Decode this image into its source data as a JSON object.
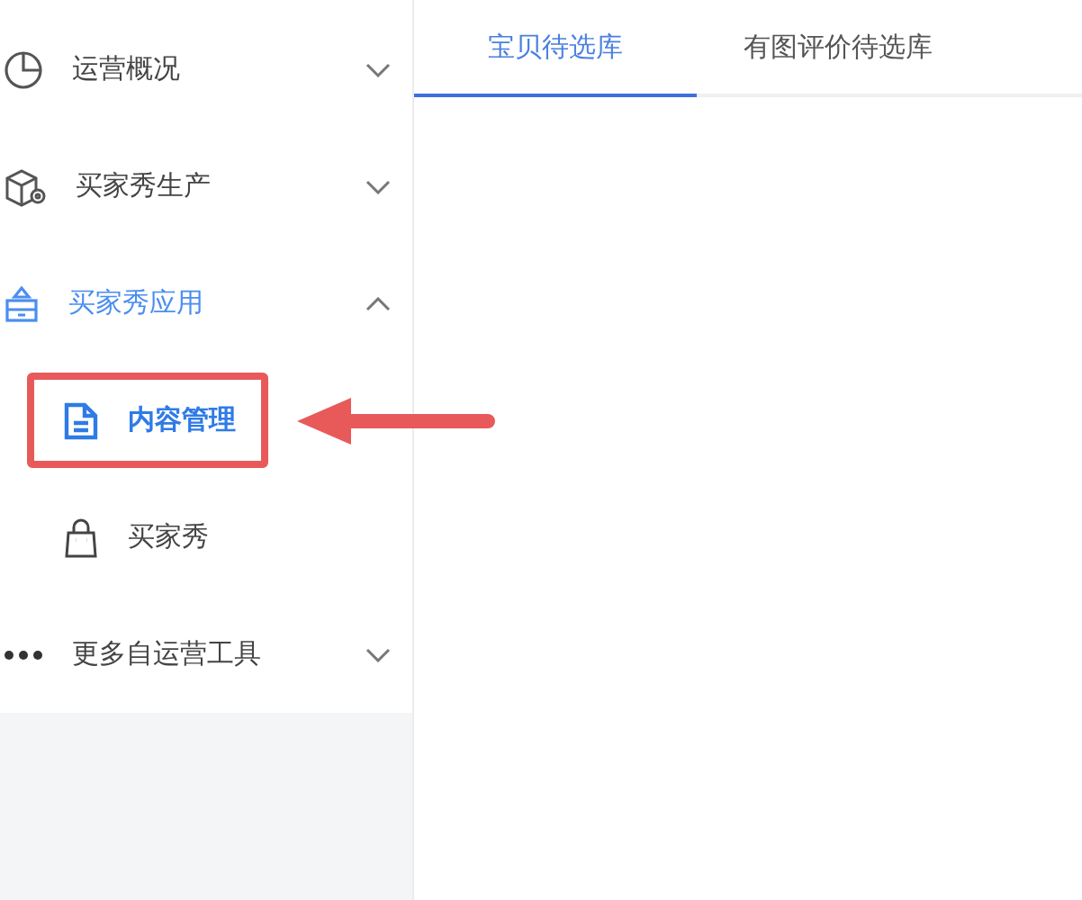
{
  "sidebar": {
    "items": [
      {
        "label": "运营概况",
        "expanded": false,
        "active": false
      },
      {
        "label": "买家秀生产",
        "expanded": false,
        "active": false
      },
      {
        "label": "买家秀应用",
        "expanded": true,
        "active": true,
        "children": [
          {
            "label": "内容管理",
            "selected": true,
            "highlighted": true
          },
          {
            "label": "买家秀",
            "selected": false,
            "highlighted": false
          }
        ]
      },
      {
        "label": "更多自运营工具",
        "expanded": false,
        "active": false
      }
    ]
  },
  "tabs": [
    {
      "label": "宝贝待选库",
      "selected": true
    },
    {
      "label": "有图评价待选库",
      "selected": false
    }
  ]
}
